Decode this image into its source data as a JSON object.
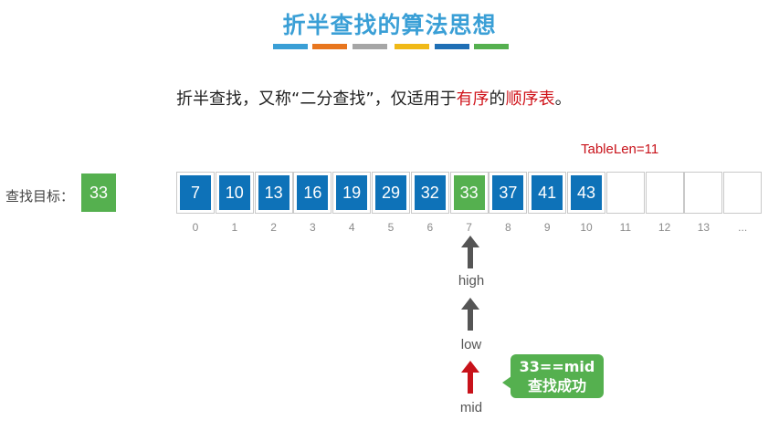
{
  "title": "折半查找的算法思想",
  "color_bars": [
    "#3a9fd6",
    "#e8761e",
    "#a6a6a6",
    "#f0b917",
    "#1f6fb5",
    "#55b04f"
  ],
  "subtitle": {
    "prefix": "折半查找，又称“二分查找”，仅适用于",
    "red1": "有序",
    "middle": "的",
    "red2": "顺序表",
    "suffix": "。"
  },
  "table_len": "TableLen=11",
  "target": {
    "label": "查找目标：",
    "value": "33"
  },
  "cells": [
    "7",
    "10",
    "13",
    "16",
    "19",
    "29",
    "32",
    "33",
    "37",
    "41",
    "43",
    "",
    "",
    "",
    ""
  ],
  "found_index": 7,
  "indices": [
    "0",
    "1",
    "2",
    "3",
    "4",
    "5",
    "6",
    "7",
    "8",
    "9",
    "10",
    "11",
    "12",
    "13",
    "..."
  ],
  "pointers": {
    "high": "high",
    "low": "low",
    "mid": "mid"
  },
  "pointer_colors": {
    "high": "#555555",
    "low": "#555555",
    "mid": "#c8121a"
  },
  "result": {
    "line1": "33==mid",
    "line2": "查找成功"
  }
}
